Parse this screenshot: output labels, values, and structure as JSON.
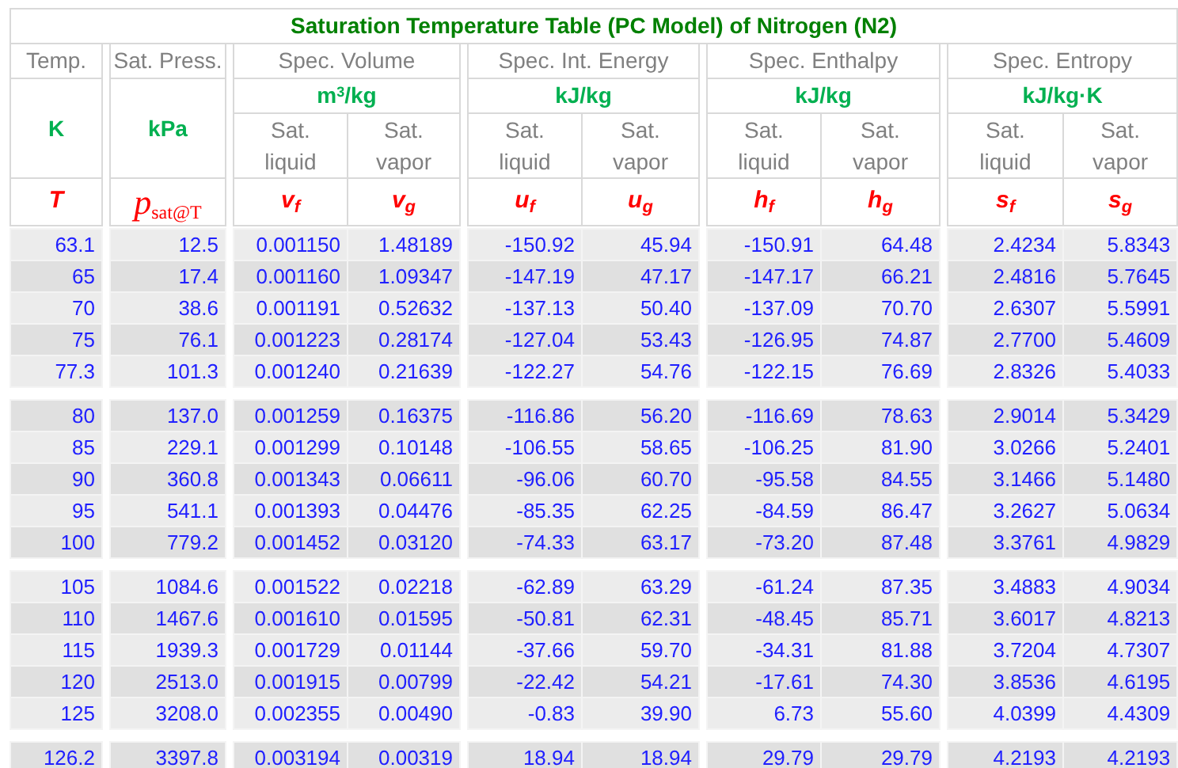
{
  "title": "Saturation Temperature Table (PC Model) of Nitrogen (N2)",
  "columns": [
    {
      "heading": "Temp.",
      "unit": "K",
      "symbol": "T",
      "kind": "plain"
    },
    {
      "heading": "Sat. Press.",
      "unit": "kPa",
      "symbol": "p$_{sat@T}$",
      "kind": "math"
    },
    {
      "heading": "Spec. Volume",
      "unit": "m$^{3}$/kg",
      "subcolumns": [
        {
          "label": "Sat. liquid",
          "symbol": "v$_{f}$"
        },
        {
          "label": "Sat. vapor",
          "symbol": "v$_{g}$"
        }
      ]
    },
    {
      "heading": "Spec. Int. Energy",
      "unit": "kJ/kg",
      "subcolumns": [
        {
          "label": "Sat. liquid",
          "symbol": "u$_{f}$"
        },
        {
          "label": "Sat. vapor",
          "symbol": "u$_{g}$"
        }
      ]
    },
    {
      "heading": "Spec. Enthalpy",
      "unit": "kJ/kg",
      "subcolumns": [
        {
          "label": "Sat. liquid",
          "symbol": "h$_{f}$"
        },
        {
          "label": "Sat. vapor",
          "symbol": "h$_{g}$"
        }
      ]
    },
    {
      "heading": "Spec. Entropy",
      "unit": "kJ/kg·K",
      "subcolumns": [
        {
          "label": "Sat. liquid",
          "symbol": "s$_{f}$"
        },
        {
          "label": "Sat. vapor",
          "symbol": "s$_{g}$"
        }
      ]
    }
  ],
  "row_groups": [
    [
      [
        "63.1",
        "12.5",
        "0.001150",
        "1.48189",
        "-150.92",
        "45.94",
        "-150.91",
        "64.48",
        "2.4234",
        "5.8343"
      ],
      [
        "65",
        "17.4",
        "0.001160",
        "1.09347",
        "-147.19",
        "47.17",
        "-147.17",
        "66.21",
        "2.4816",
        "5.7645"
      ],
      [
        "70",
        "38.6",
        "0.001191",
        "0.52632",
        "-137.13",
        "50.40",
        "-137.09",
        "70.70",
        "2.6307",
        "5.5991"
      ],
      [
        "75",
        "76.1",
        "0.001223",
        "0.28174",
        "-127.04",
        "53.43",
        "-126.95",
        "74.87",
        "2.7700",
        "5.4609"
      ],
      [
        "77.3",
        "101.3",
        "0.001240",
        "0.21639",
        "-122.27",
        "54.76",
        "-122.15",
        "76.69",
        "2.8326",
        "5.4033"
      ]
    ],
    [
      [
        "80",
        "137.0",
        "0.001259",
        "0.16375",
        "-116.86",
        "56.20",
        "-116.69",
        "78.63",
        "2.9014",
        "5.3429"
      ],
      [
        "85",
        "229.1",
        "0.001299",
        "0.10148",
        "-106.55",
        "58.65",
        "-106.25",
        "81.90",
        "3.0266",
        "5.2401"
      ],
      [
        "90",
        "360.8",
        "0.001343",
        "0.06611",
        "-96.06",
        "60.70",
        "-95.58",
        "84.55",
        "3.1466",
        "5.1480"
      ],
      [
        "95",
        "541.1",
        "0.001393",
        "0.04476",
        "-85.35",
        "62.25",
        "-84.59",
        "86.47",
        "3.2627",
        "5.0634"
      ],
      [
        "100",
        "779.2",
        "0.001452",
        "0.03120",
        "-74.33",
        "63.17",
        "-73.20",
        "87.48",
        "3.3761",
        "4.9829"
      ]
    ],
    [
      [
        "105",
        "1084.6",
        "0.001522",
        "0.02218",
        "-62.89",
        "63.29",
        "-61.24",
        "87.35",
        "3.4883",
        "4.9034"
      ],
      [
        "110",
        "1467.6",
        "0.001610",
        "0.01595",
        "-50.81",
        "62.31",
        "-48.45",
        "85.71",
        "3.6017",
        "4.8213"
      ],
      [
        "115",
        "1939.3",
        "0.001729",
        "0.01144",
        "-37.66",
        "59.70",
        "-34.31",
        "81.88",
        "3.7204",
        "4.7307"
      ],
      [
        "120",
        "2513.0",
        "0.001915",
        "0.00799",
        "-22.42",
        "54.21",
        "-17.61",
        "74.30",
        "3.8536",
        "4.6195"
      ],
      [
        "125",
        "3208.0",
        "0.002355",
        "0.00490",
        "-0.83",
        "39.90",
        "6.73",
        "55.60",
        "4.0399",
        "4.4309"
      ]
    ],
    [
      [
        "126.2",
        "3397.8",
        "0.003194",
        "0.00319",
        "18.94",
        "18.94",
        "29.79",
        "29.79",
        "4.2193",
        "4.2193"
      ]
    ]
  ]
}
